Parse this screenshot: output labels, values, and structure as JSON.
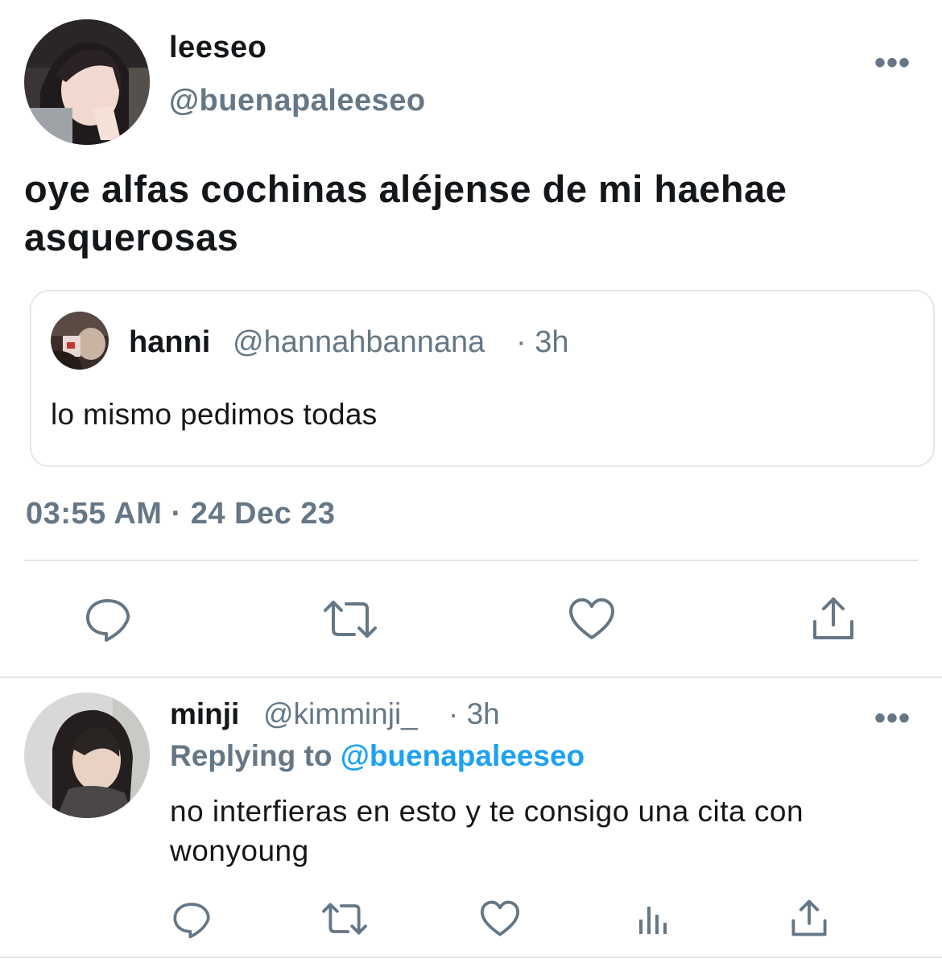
{
  "main_tweet": {
    "display_name": "leeseo",
    "handle": "@buenapaleeseo",
    "more_glyph": "•••",
    "text": "oye alfas cochinas aléjense de mi haehae asquerosas",
    "timestamp": "03:55 AM · 24 Dec 23",
    "quoted": {
      "display_name": "hanni",
      "handle": "@hannahbannana",
      "time": "· 3h",
      "text": "lo mismo pedimos todas"
    },
    "actions": [
      "reply-icon",
      "retweet-icon",
      "like-icon",
      "share-icon"
    ]
  },
  "reply_tweet": {
    "display_name": "minji",
    "handle": "@kimminji_",
    "time": "· 3h",
    "more_glyph": "•••",
    "replying_label": "Replying to",
    "replying_mention": "@buenapaleeseo",
    "text": "no interfieras en esto y te consigo una cita con wonyoung",
    "actions": [
      "reply-icon",
      "retweet-icon",
      "like-icon",
      "analytics-icon",
      "share-icon"
    ]
  },
  "colors": {
    "text": "#14171a",
    "secondary": "#657786",
    "link": "#1da1f2",
    "border": "#e1e8ed"
  }
}
